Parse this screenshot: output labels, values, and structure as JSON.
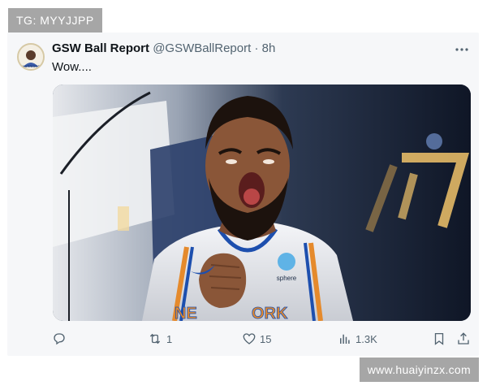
{
  "overlay": {
    "tg_label": "TG: MYYJJPP",
    "watermark": "www.huaiyinzx.com"
  },
  "tweet": {
    "display_name": "GSW Ball Report",
    "handle": "@GSWBallReport",
    "separator": "·",
    "time": "8h",
    "text": "Wow....",
    "media_description_icons": [
      "basketball-player-photo"
    ],
    "jersey_sponsor": "Sphere",
    "jersey_text": "NEW YORK"
  },
  "actions": {
    "reply": {
      "icon": "reply-icon",
      "count": ""
    },
    "retweet": {
      "icon": "retweet-icon",
      "count": "1"
    },
    "like": {
      "icon": "heart-icon",
      "count": "15"
    },
    "views": {
      "icon": "views-icon",
      "count": "1.3K"
    },
    "bookmark": {
      "icon": "bookmark-icon"
    },
    "share": {
      "icon": "share-icon"
    }
  },
  "colors": {
    "card_bg": "#f6f7f9",
    "muted_text": "#536471",
    "primary_text": "#0f1419",
    "label_bg": "#a6a6a6"
  }
}
